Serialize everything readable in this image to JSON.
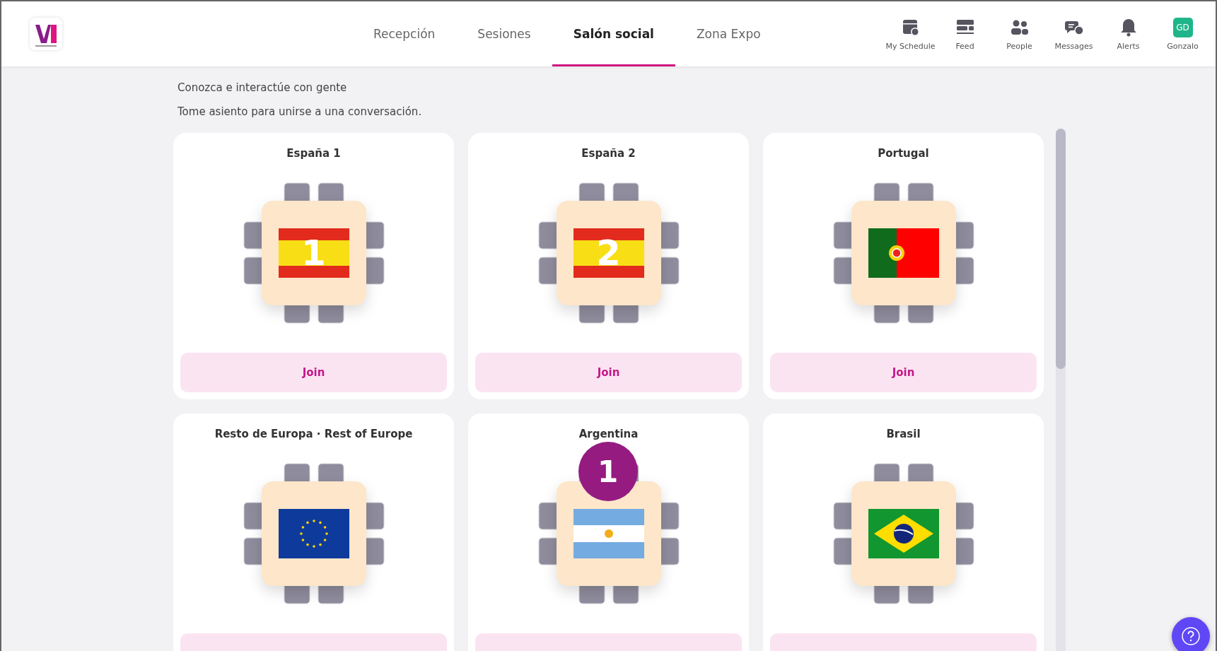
{
  "nav_tabs": [
    {
      "label": "Recepción",
      "selected": false
    },
    {
      "label": "Sesiones",
      "selected": false
    },
    {
      "label": "Salón social",
      "selected": true
    },
    {
      "label": "Zona Expo",
      "selected": false
    }
  ],
  "toolbar": [
    {
      "kind": "schedule",
      "label": "My Schedule"
    },
    {
      "kind": "feed",
      "label": "Feed"
    },
    {
      "kind": "people",
      "label": "People"
    },
    {
      "kind": "messages",
      "label": "Messages"
    },
    {
      "kind": "alerts",
      "label": "Alerts"
    },
    {
      "kind": "avatar",
      "initials": "GD",
      "label": "Gonzalo"
    }
  ],
  "intro": [
    "Conozca e interactúe con gente",
    "Tome asiento para unirse a una conversación."
  ],
  "tables": [
    {
      "name": "España 1",
      "kind": "spain",
      "flag_label": "1",
      "join": "Join"
    },
    {
      "name": "España 2",
      "kind": "spain",
      "flag_label": "2",
      "join": "Join"
    },
    {
      "name": "Portugal",
      "kind": "portugal",
      "join": "Join"
    },
    {
      "name": "Resto de Europa · Rest of Europe",
      "kind": "eu"
    },
    {
      "name": "Argentina",
      "kind": "argentina",
      "badge": "1"
    },
    {
      "name": "Brasil",
      "kind": "brazil"
    }
  ]
}
